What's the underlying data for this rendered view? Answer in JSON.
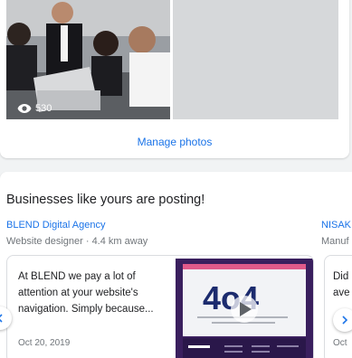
{
  "photos": {
    "view_count": "530",
    "manage_label": "Manage photos"
  },
  "businesses": {
    "title": "Businesses like yours are posting!",
    "items": [
      {
        "name": "BLEND Digital Agency",
        "subtitle": "Website designer · 4.4 km away",
        "post_text": "At BLEND we pay a lot of attention at your website's navigation. Simply because...",
        "post_date": "Oct 20, 2019",
        "image_text": "4o4"
      },
      {
        "name": "NISAK",
        "subtitle": "Manuf",
        "post_text": "Did ave",
        "post_date": "Oct"
      }
    ]
  },
  "colors": {
    "link": "#1a73e8",
    "secondary_text": "#70757a",
    "post_image_bg": "#3a1f5e"
  }
}
